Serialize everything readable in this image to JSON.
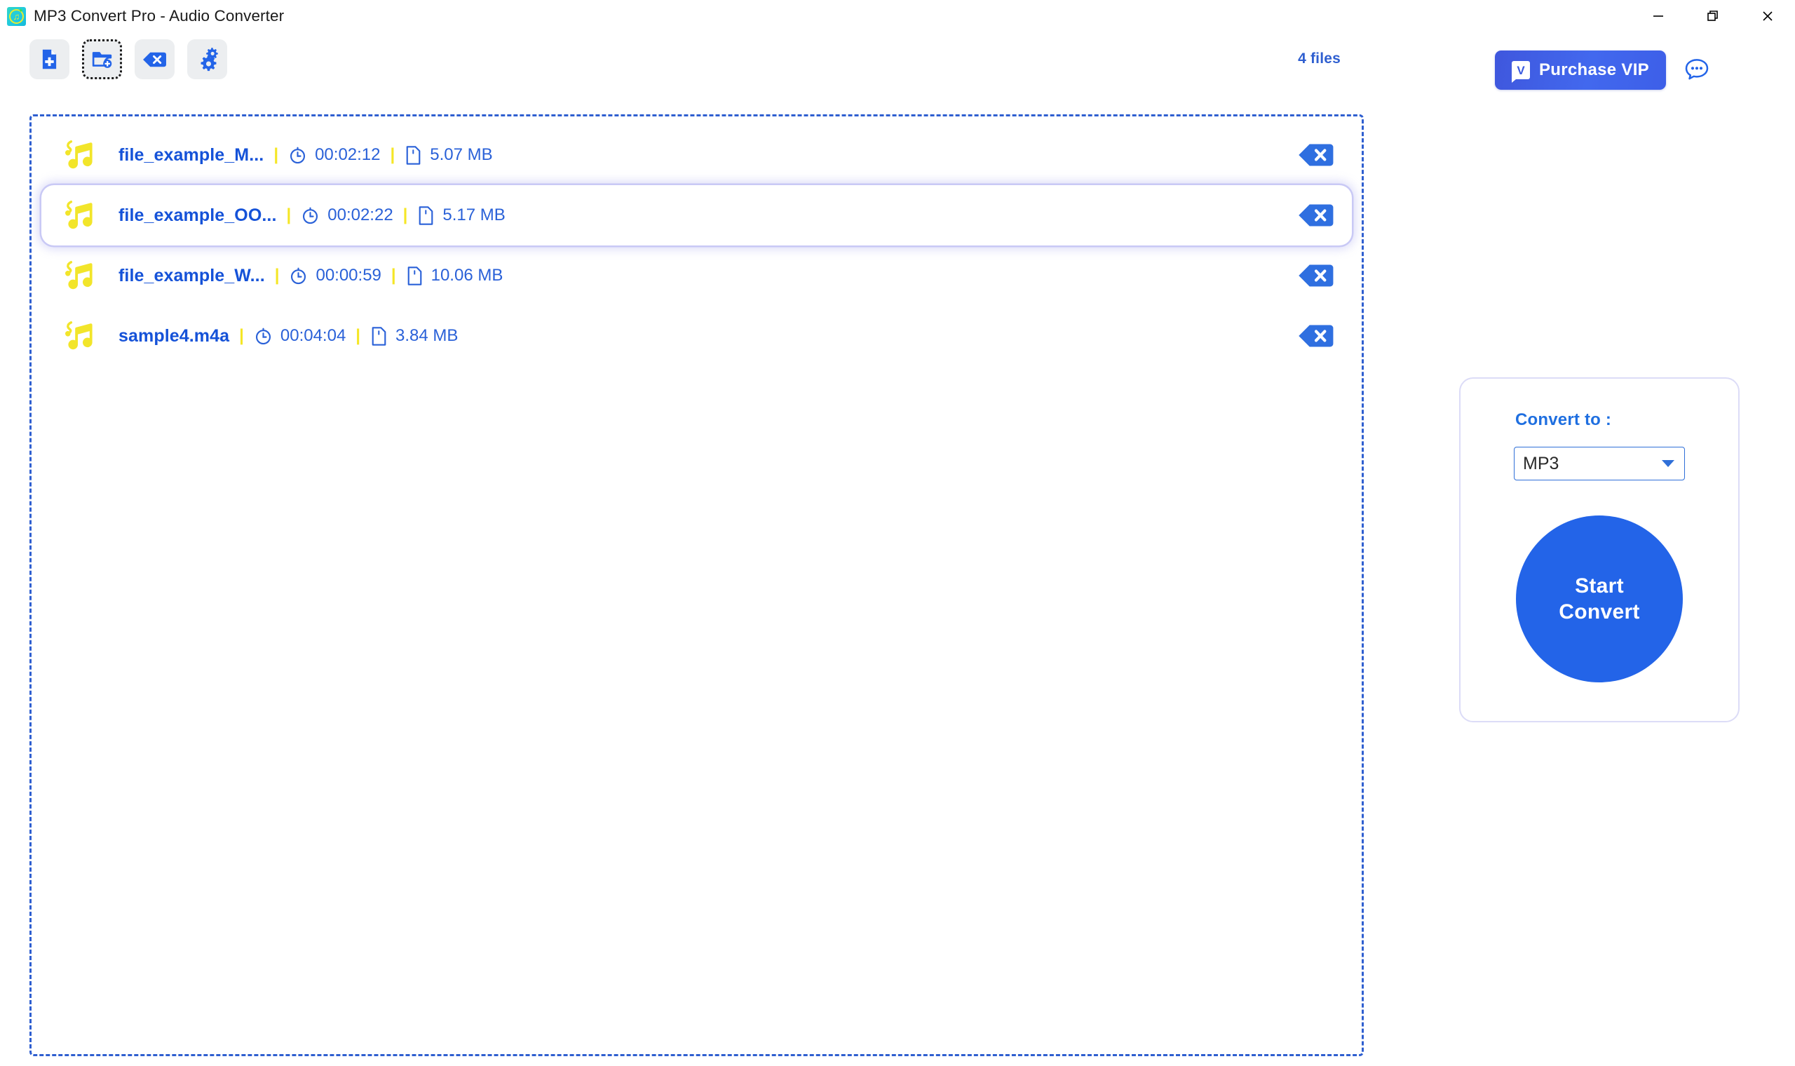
{
  "window": {
    "title": "MP3 Convert Pro - Audio Converter",
    "app_icon": "music-note-app-icon",
    "controls": {
      "minimize": "minimize-icon",
      "restore": "restore-icon",
      "close": "close-icon"
    }
  },
  "toolbar": {
    "buttons": [
      {
        "name": "add-file-button",
        "icon": "file-plus-icon",
        "focused": false
      },
      {
        "name": "add-folder-button",
        "icon": "folder-plus-icon",
        "focused": true
      },
      {
        "name": "clear-list-button",
        "icon": "backspace-delete-icon",
        "focused": false
      },
      {
        "name": "settings-button",
        "icon": "gears-icon",
        "focused": false
      }
    ],
    "file_count_label": "4 files"
  },
  "header_actions": {
    "vip_button_label": "Purchase VIP",
    "vip_badge_letter": "V",
    "chat_icon": "chat-bubble-icon"
  },
  "file_list": {
    "rows": [
      {
        "name": "file_example_M...",
        "duration": "00:02:12",
        "size": "5.07 MB",
        "selected": false,
        "separator": "|"
      },
      {
        "name": "file_example_OO...",
        "duration": "00:02:22",
        "size": "5.17 MB",
        "selected": true,
        "separator": "|"
      },
      {
        "name": "file_example_W...",
        "duration": "00:00:59",
        "size": "10.06 MB",
        "selected": false,
        "separator": "|"
      },
      {
        "name": "sample4.m4a",
        "duration": "00:04:04",
        "size": "3.84 MB",
        "selected": false,
        "separator": "|"
      }
    ]
  },
  "convert_panel": {
    "label": "Convert to :",
    "format_value": "MP3",
    "format_options": [
      "MP3"
    ],
    "start_line1": "Start",
    "start_line2": "Convert"
  },
  "colors": {
    "accent_blue": "#2364e8",
    "link_blue": "#1552d8",
    "note_yellow": "#f2e52a",
    "dashed_border": "#2f5fd0",
    "panel_border": "#dcdcf7",
    "vip_gradient_start": "#3f57dd",
    "vip_gradient_end": "#3d5fe8"
  }
}
